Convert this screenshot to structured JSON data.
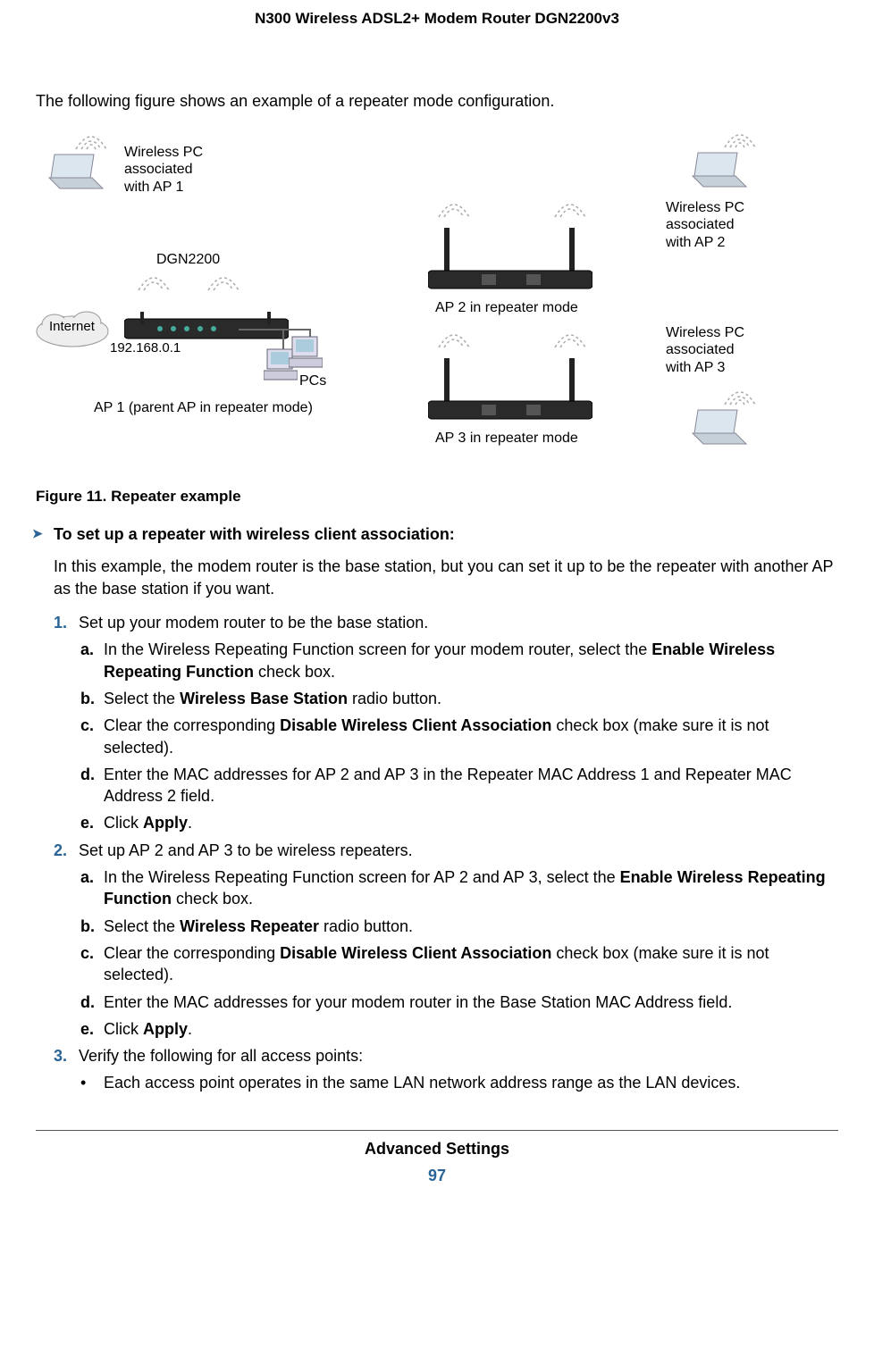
{
  "header": "N300 Wireless ADSL2+ Modem Router DGN2200v3",
  "intro": "The following figure shows an example of a repeater mode configuration.",
  "diagram": {
    "pc_ap1": "Wireless PC\nassociated\nwith AP 1",
    "pc_ap2": "Wireless PC\nassociated\nwith AP 2",
    "pc_ap3": "Wireless PC\nassociated\nwith AP 3",
    "dgn": "DGN2200",
    "internet": "Internet",
    "ip": "192.168.0.1",
    "pcs": "PCs",
    "ap1": "AP 1 (parent AP in repeater mode)",
    "ap2": "AP 2 in repeater mode",
    "ap3": "AP 3 in repeater mode"
  },
  "figure_caption": "Figure 11. Repeater example",
  "proc_heading": "To set up a repeater with wireless client association:",
  "proc_intro": "In this example, the modem router is the base station, but you can set it up to be the repeater with another AP as the base station if you want.",
  "steps": {
    "s1": "Set up your modem router to be the base station.",
    "s1a_pre": "In the Wireless Repeating Function screen for your modem router, select the ",
    "s1a_bold": "Enable Wireless Repeating Function",
    "s1a_post": " check box.",
    "s1b_pre": "Select the ",
    "s1b_bold": "Wireless Base Station",
    "s1b_post": " radio button.",
    "s1c_pre": "Clear the corresponding ",
    "s1c_bold": "Disable Wireless Client Association",
    "s1c_post": " check box (make sure it is not selected).",
    "s1d": "Enter the MAC addresses for AP 2 and AP 3 in the Repeater MAC Address 1 and Repeater MAC Address 2 field.",
    "s1e_pre": "Click ",
    "s1e_bold": "Apply",
    "s1e_post": ".",
    "s2": "Set up AP 2 and AP 3 to be wireless repeaters.",
    "s2a_pre": "In the Wireless Repeating Function screen for AP 2 and AP 3, select the ",
    "s2a_bold": "Enable Wireless Repeating Function",
    "s2a_post": " check box.",
    "s2b_pre": "Select the ",
    "s2b_bold": "Wireless Repeater",
    "s2b_post": " radio button.",
    "s2c_pre": "Clear the corresponding ",
    "s2c_bold": "Disable Wireless Client Association",
    "s2c_post": " check box (make sure it is not selected).",
    "s2d": "Enter the MAC addresses for your modem router in the Base Station MAC Address field.",
    "s2e_pre": "Click ",
    "s2e_bold": "Apply",
    "s2e_post": ".",
    "s3": "Verify the following for all access points:",
    "s3b1": "Each access point operates in the same LAN network address range as the LAN devices."
  },
  "footer_section": "Advanced Settings",
  "page_number": "97"
}
